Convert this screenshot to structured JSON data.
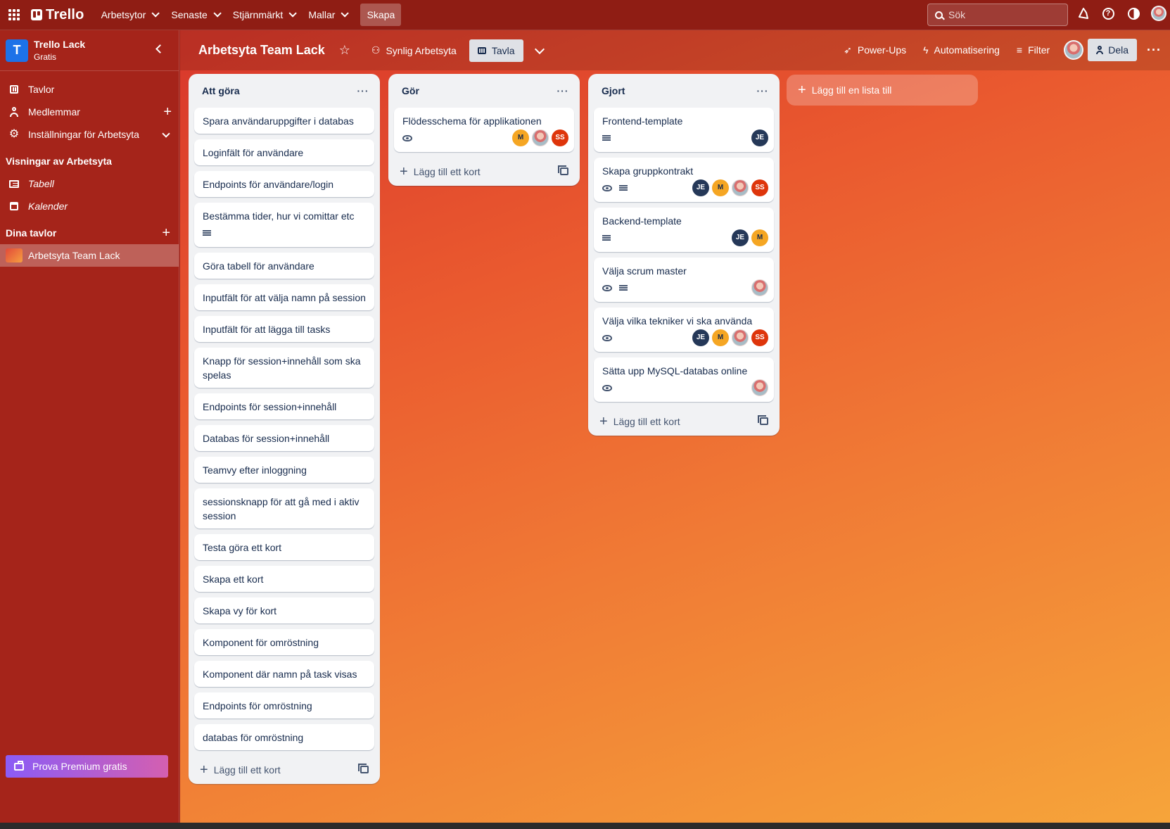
{
  "topnav": {
    "logo": "Trello",
    "menus": [
      {
        "label": "Arbetsytor"
      },
      {
        "label": "Senaste"
      },
      {
        "label": "Stjärnmärkt"
      },
      {
        "label": "Mallar"
      }
    ],
    "create_label": "Skapa",
    "search_placeholder": "Sök"
  },
  "sidebar": {
    "workspace_initial": "T",
    "workspace_name": "Trello Lack",
    "workspace_plan": "Gratis",
    "items": [
      {
        "label": "Tavlor",
        "icon": "board-icon"
      },
      {
        "label": "Medlemmar",
        "icon": "person-icon"
      },
      {
        "label": "Inställningar för Arbetsyta",
        "icon": "gear-icon"
      }
    ],
    "views_heading": "Visningar av Arbetsyta",
    "views": [
      {
        "label": "Tabell",
        "icon": "table-icon"
      },
      {
        "label": "Kalender",
        "icon": "calendar-icon"
      }
    ],
    "boards_heading": "Dina tavlor",
    "boards": [
      {
        "label": "Arbetsyta Team Lack"
      }
    ],
    "premium_label": "Prova Premium gratis"
  },
  "board": {
    "title": "Arbetsyta Team Lack",
    "visibility_label": "Synlig Arbetsyta",
    "view_label": "Tavla",
    "powerups_label": "Power-Ups",
    "automation_label": "Automatisering",
    "filter_label": "Filter",
    "share_label": "Dela",
    "add_list_label": "Lägg till en lista till"
  },
  "lists": [
    {
      "title": "Att göra",
      "add_card_label": "Lägg till ett kort",
      "cards": [
        {
          "title": "Spara användaruppgifter i databas"
        },
        {
          "title": "Loginfält för användare"
        },
        {
          "title": "Endpoints för användare/login"
        },
        {
          "title": "Bestämma tider, hur vi comittar etc",
          "badges": [
            "description"
          ]
        },
        {
          "title": "Göra tabell för användare"
        },
        {
          "title": "Inputfält för att välja namn på session"
        },
        {
          "title": "Inputfält för att lägga till tasks"
        },
        {
          "title": "Knapp för session+innehåll som ska spelas"
        },
        {
          "title": "Endpoints för session+innehåll"
        },
        {
          "title": "Databas för session+innehåll"
        },
        {
          "title": "Teamvy efter inloggning"
        },
        {
          "title": "sessionsknapp för att gå med i aktiv session"
        },
        {
          "title": "Testa göra ett kort"
        },
        {
          "title": "Skapa ett kort"
        },
        {
          "title": "Skapa vy för kort"
        },
        {
          "title": "Komponent för omröstning"
        },
        {
          "title": "Komponent där namn på task visas"
        },
        {
          "title": "Endpoints för omröstning"
        },
        {
          "title": "databas för omröstning"
        }
      ]
    },
    {
      "title": "Gör",
      "add_card_label": "Lägg till ett kort",
      "cards": [
        {
          "title": "Flödesschema för applikationen",
          "badges": [
            "watch"
          ],
          "members": [
            "M",
            "photo",
            "SS"
          ]
        }
      ]
    },
    {
      "title": "Gjort",
      "add_card_label": "Lägg till ett kort",
      "cards": [
        {
          "title": "Frontend-template",
          "badges": [
            "description"
          ],
          "members": [
            "JE"
          ]
        },
        {
          "title": "Skapa gruppkontrakt",
          "badges": [
            "watch",
            "description"
          ],
          "members": [
            "JE",
            "M",
            "photo",
            "SS"
          ]
        },
        {
          "title": "Backend-template",
          "badges": [
            "description"
          ],
          "members": [
            "JE",
            "M"
          ]
        },
        {
          "title": "Välja scrum master",
          "badges": [
            "watch",
            "description"
          ],
          "members": [
            "photo"
          ]
        },
        {
          "title": "Välja vilka tekniker vi ska använda",
          "badges": [
            "watch"
          ],
          "members": [
            "JE",
            "M",
            "photo",
            "SS"
          ]
        },
        {
          "title": "Sätta upp MySQL-databas online",
          "badges": [
            "watch"
          ],
          "members": [
            "photo"
          ]
        }
      ]
    }
  ],
  "colors": {
    "topnav": "#8f1d14",
    "sidebar": "#a5241a",
    "board_gradient_start": "#d8372b",
    "board_gradient_end": "#f6a53a",
    "list_bg": "#f1f2f4",
    "avatar_je": "#253858",
    "avatar_m": "#f5a623",
    "avatar_ss": "#de350b",
    "premium_gradient": "#8b5cf6"
  }
}
